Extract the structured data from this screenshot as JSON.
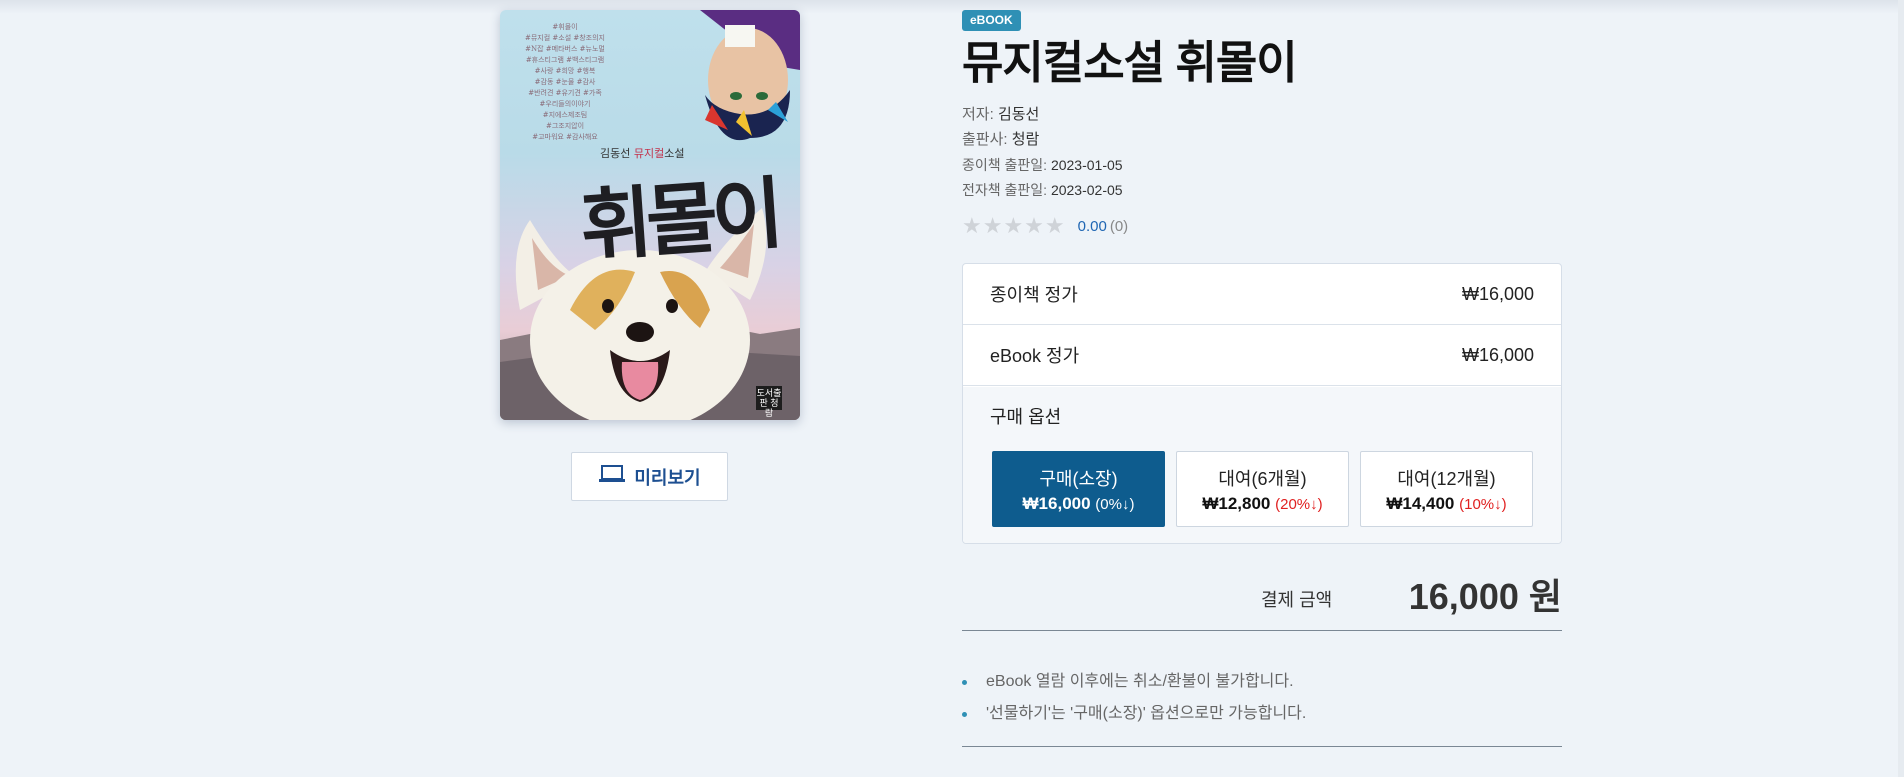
{
  "cover": {
    "tags": [
      "#휘몰이",
      "#뮤지컬 #소설 #창조의지",
      "#N잡 #메타버스 #뉴노멀",
      "#휴스티그램 #백스티그램",
      "#사랑 #희망 #행복",
      "#감동 #눈물 #감사",
      "#반려견 #유기견 #가족",
      "#우리들의이야기",
      "#지에스제조팀",
      "#그조지압이",
      "#고마워요 #감사해요"
    ],
    "author_prefix": "김동선",
    "author_highlight": "뮤지컬",
    "author_suffix": "소설",
    "title": "휘몰이",
    "publisher_mark": "도서출판 청람"
  },
  "preview": {
    "label": "미리보기",
    "icon": "laptop-icon"
  },
  "badge": "eBOOK",
  "title": "뮤지컬소설 휘몰이",
  "meta": [
    {
      "key": "저자:",
      "value": "김동선"
    },
    {
      "key": "출판사:",
      "value": "청람"
    },
    {
      "key": "종이책 출판일:",
      "value": "2023-01-05"
    },
    {
      "key": "전자책 출판일:",
      "value": "2023-02-05"
    }
  ],
  "rating": {
    "stars": "★★★★★",
    "score": "0.00",
    "count": "(0)",
    "value": 0
  },
  "prices": [
    {
      "label": "종이책 정가",
      "value": "₩16,000"
    },
    {
      "label": "eBook 정가",
      "value": "₩16,000"
    }
  ],
  "purchase": {
    "label": "구매 옵션",
    "options": [
      {
        "name": "구매(소장)",
        "price": "₩16,000",
        "discount": "(0%↓)",
        "selected": true
      },
      {
        "name": "대여(6개월)",
        "price": "₩12,800",
        "discount": "(20%↓)",
        "selected": false
      },
      {
        "name": "대여(12개월)",
        "price": "₩14,400",
        "discount": "(10%↓)",
        "selected": false
      }
    ]
  },
  "total": {
    "label": "결제 금액",
    "value": "16,000 원"
  },
  "notes": [
    "eBook 열람 이후에는 취소/환불이 불가합니다.",
    "'선물하기'는 '구매(소장)' 옵션으로만 가능합니다."
  ],
  "colors": {
    "accent": "#0e5c8e",
    "badge": "#2f90b5",
    "discount": "#e02020",
    "background": "#eef3f8"
  }
}
